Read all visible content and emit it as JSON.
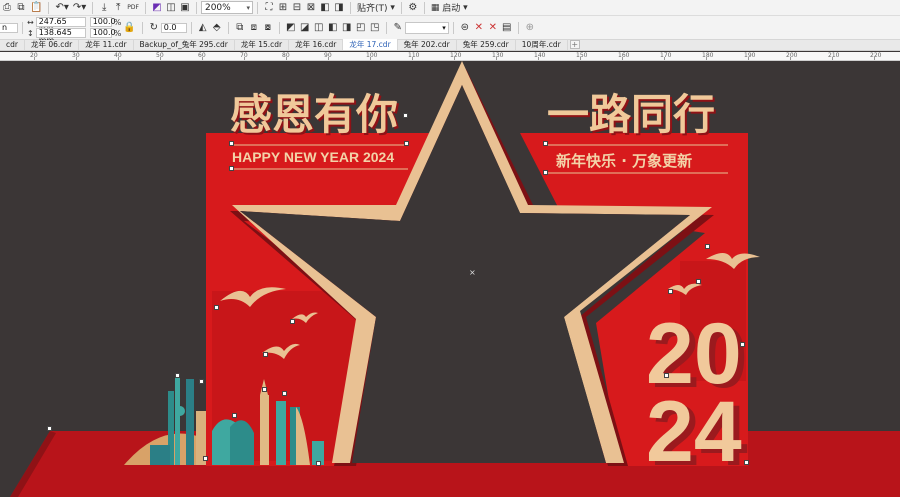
{
  "toolbar": {
    "zoom_value": "200%",
    "align_label": "贴齐(T)",
    "launch_label": "启动"
  },
  "props": {
    "width": "247.65 mm",
    "height": "138.645 mm",
    "scale_w": "100.0",
    "scale_h": "100.0",
    "percent": "%",
    "rotation": "0.0"
  },
  "tabs": [
    "cdr",
    "龙年 06.cdr",
    "龙年 11.cdr",
    "Backup_of_兔年 295.cdr",
    "龙年 15.cdr",
    "龙年 16.cdr",
    "龙年 17.cdr",
    "兔年 202.cdr",
    "兔年 259.cdr",
    "10周年.cdr"
  ],
  "active_tab": 6,
  "ruler": [
    "20",
    "30",
    "40",
    "50",
    "60",
    "70",
    "80",
    "90",
    "100",
    "110",
    "120",
    "130",
    "140",
    "150",
    "160",
    "170",
    "180",
    "190",
    "200",
    "210",
    "220"
  ],
  "design": {
    "headline_left": "感恩有你",
    "headline_right": "一路同行",
    "happy_new_year": "HAPPY NEW YEAR 2024",
    "slogan": "新年快乐 · 万象更新",
    "year_top": "20",
    "year_bottom": "24"
  },
  "colors": {
    "canvas_bg": "#3b3636",
    "red": "#d71a1c",
    "dark_red": "#8f1216",
    "gold": "#e9c193",
    "gold_dark": "#c9955f",
    "floor": "#b8141a"
  }
}
